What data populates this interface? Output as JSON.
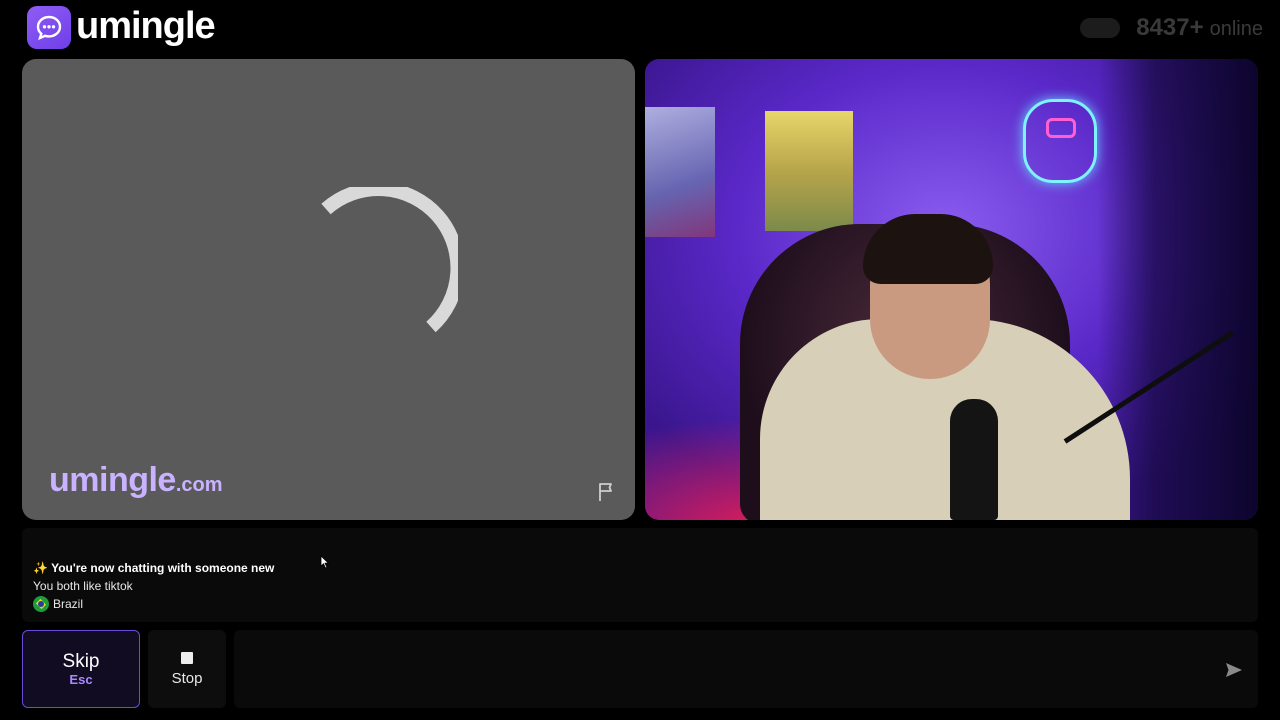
{
  "brand": {
    "name": "umingle",
    "watermark_main": "umingle",
    "watermark_domain": ".com",
    "accent": "#7c4dff"
  },
  "status": {
    "online_count": "8437+",
    "online_label": "online"
  },
  "chat": {
    "messages": [
      {
        "icon": "sparkles-icon",
        "text": "You're now chatting with someone new"
      },
      {
        "text": "You both like tiktok"
      },
      {
        "icon": "brazil-flag-icon",
        "text": "Brazil"
      }
    ]
  },
  "controls": {
    "skip_label": "Skip",
    "skip_shortcut": "Esc",
    "stop_label": "Stop",
    "message_placeholder": ""
  }
}
